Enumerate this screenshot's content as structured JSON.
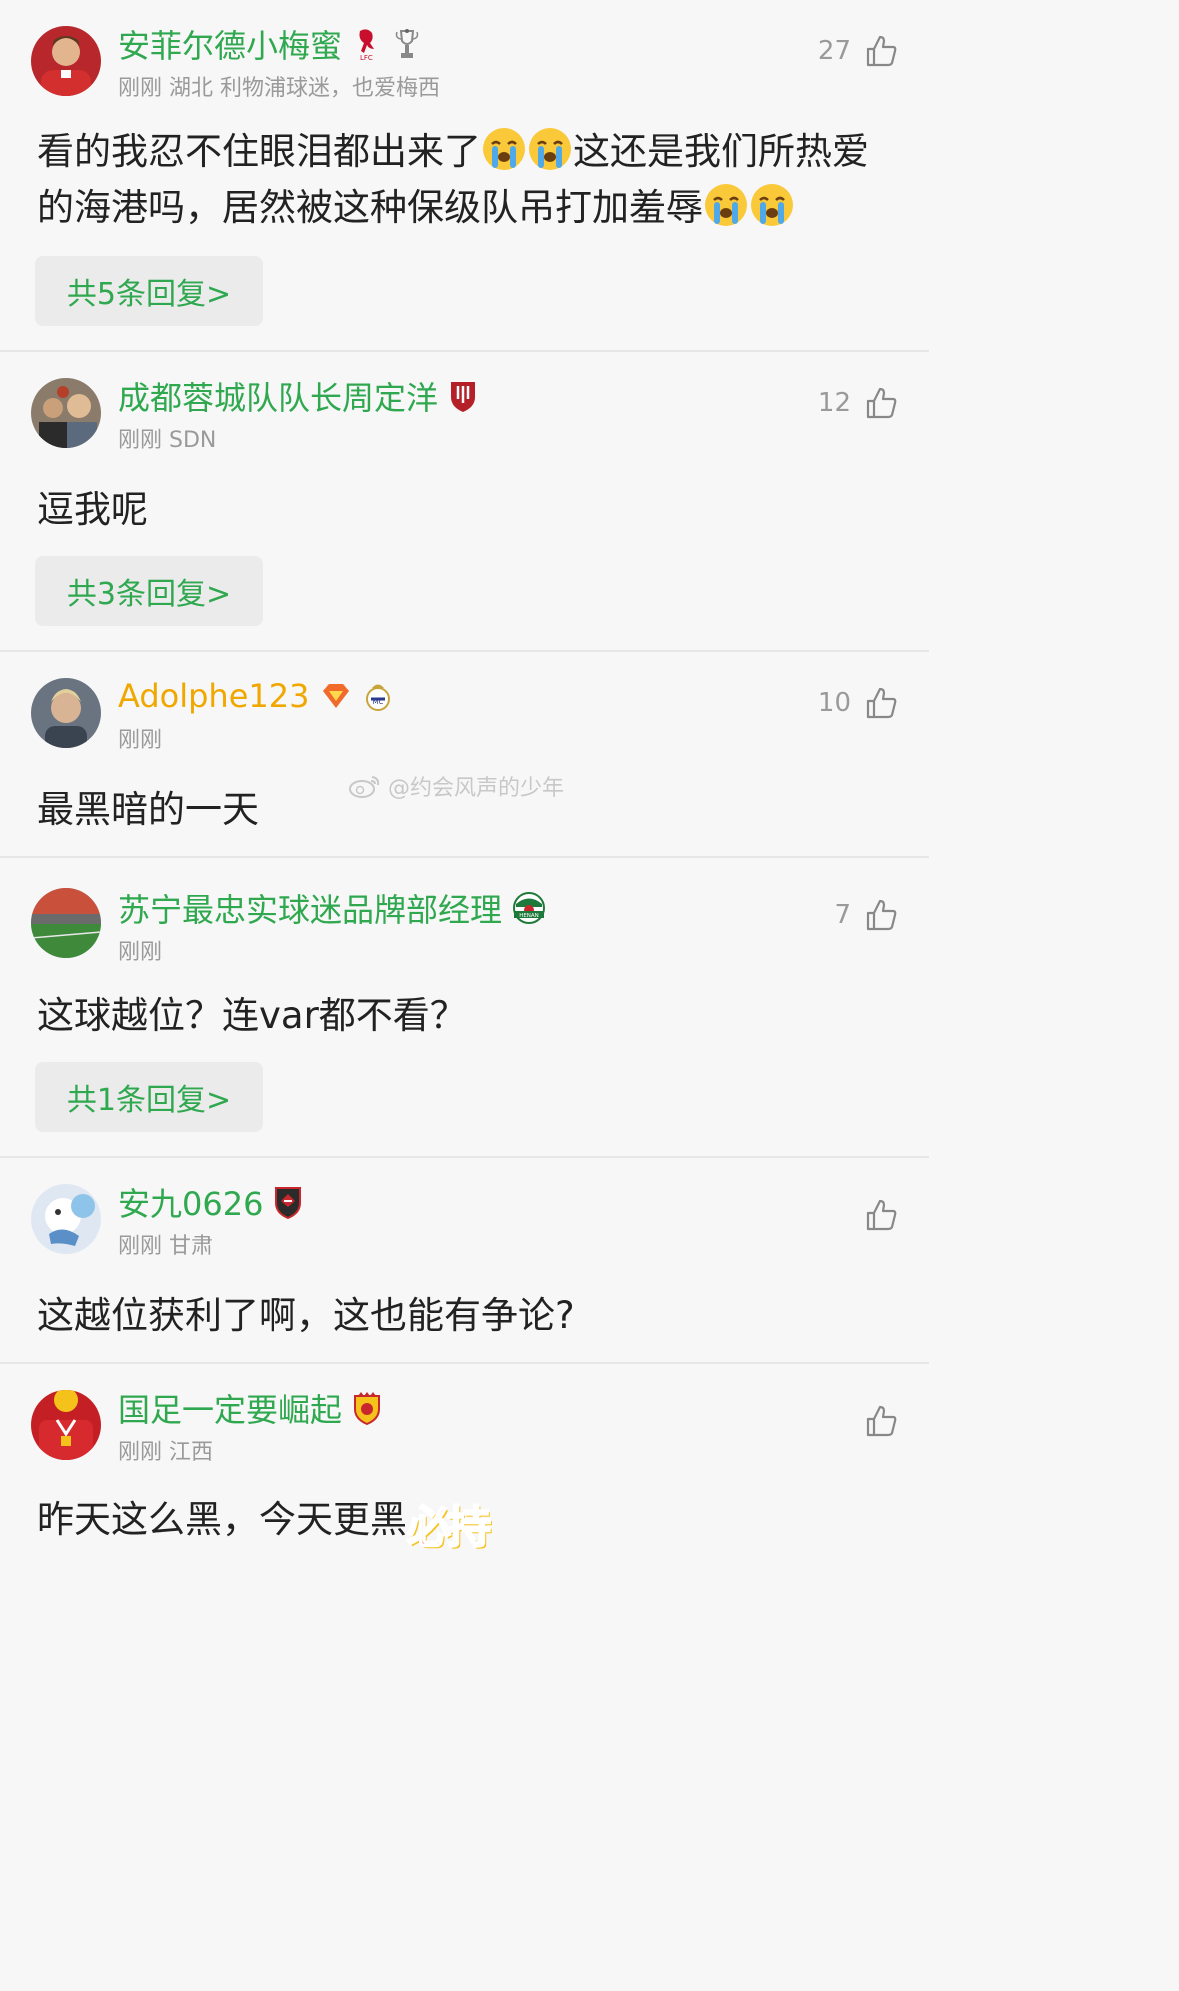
{
  "comments": [
    {
      "name": "安菲尔德小梅蜜",
      "meta": "刚刚 湖北 利物浦球迷，也爱梅西",
      "likes": "27",
      "text_a": "看的我忍不住眼泪都出来了",
      "text_b": "这还是我们所热爱的海港吗，居然被这种保级队吊打加羞辱",
      "replies": "共5条回复>"
    },
    {
      "name": "成都蓉城队队长周定洋",
      "meta": "刚刚 SDN",
      "likes": "12",
      "text": "逗我呢",
      "replies": "共3条回复>"
    },
    {
      "name": "Adolphe123",
      "meta": "刚刚",
      "likes": "10",
      "text": "最黑暗的一天"
    },
    {
      "name": "苏宁最忠实球迷品牌部经理",
      "meta": "刚刚",
      "likes": "7",
      "text": "这球越位？连var都不看？",
      "replies": "共1条回复>",
      "badge_text": "HENAN"
    },
    {
      "name": "安九0626",
      "meta": "刚刚 甘肃",
      "text": "这越位获利了啊，这也能有争论?"
    },
    {
      "name": "国足一定要崛起",
      "meta": "刚刚 江西",
      "text": "昨天这么黑，今天更黑",
      "sticker": "必持"
    }
  ],
  "watermark": "@约会风声的少年",
  "colors": {
    "username": "#2fa84f",
    "vip_username": "#f0a800",
    "meta": "#9a9a9a",
    "reply_button_bg": "#ebebeb",
    "background": "#f7f7f7"
  },
  "icons": [
    "like-thumb-icon",
    "crying-face-emoji",
    "weibo-logo-icon"
  ]
}
